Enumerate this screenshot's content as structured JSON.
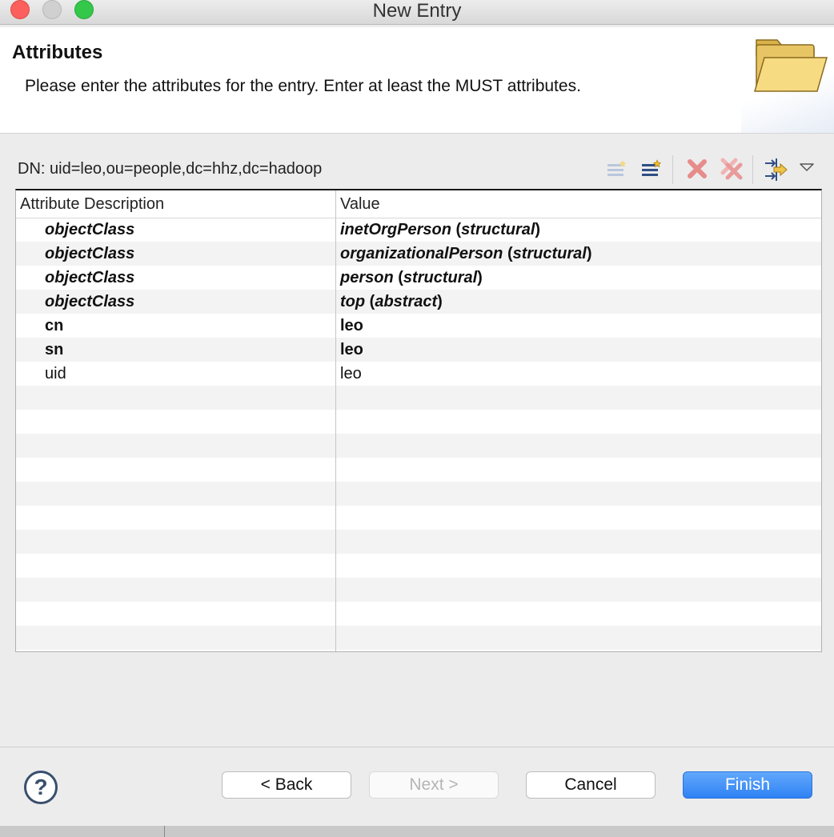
{
  "window": {
    "title": "New Entry"
  },
  "header": {
    "title": "Attributes",
    "description": "Please enter the attributes for the entry. Enter at least the MUST attributes."
  },
  "dn": {
    "label": "DN: uid=leo,ou=people,dc=hhz,dc=hadoop"
  },
  "toolbar": {
    "icons": [
      "new-attribute-icon",
      "new-value-icon",
      "delete-icon",
      "delete-all-icon",
      "edit-value-icon",
      "view-menu-icon"
    ]
  },
  "table": {
    "columns": [
      "Attribute Description",
      "Value"
    ],
    "rows": [
      {
        "attr": "objectClass",
        "value_main": "inetOrgPerson",
        "value_kind": "structural"
      },
      {
        "attr": "objectClass",
        "value_main": "organizationalPerson",
        "value_kind": "structural"
      },
      {
        "attr": "objectClass",
        "value_main": "person",
        "value_kind": "structural"
      },
      {
        "attr": "objectClass",
        "value_main": "top",
        "value_kind": "abstract"
      },
      {
        "attr": "cn",
        "value": "leo"
      },
      {
        "attr": "sn",
        "value": "leo"
      },
      {
        "attr": "uid",
        "value": "leo"
      }
    ]
  },
  "buttons": {
    "help": "?",
    "back": "< Back",
    "next": "Next >",
    "cancel": "Cancel",
    "finish": "Finish"
  },
  "colors": {
    "accent": "#2f82f5",
    "close": "#fc605c",
    "maximize": "#34c84a",
    "delete_icon": "#e05a5a"
  }
}
